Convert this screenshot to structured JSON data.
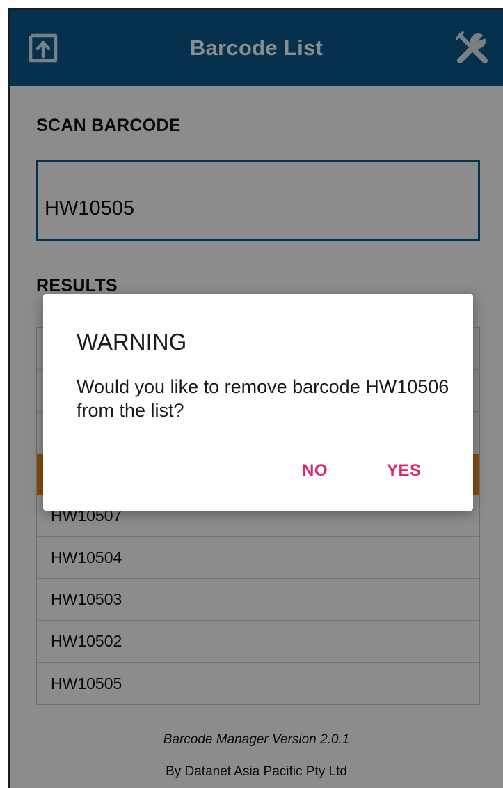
{
  "app_bar": {
    "title": "Barcode List",
    "left_icon": "upload-icon",
    "right_icon": "wrench-settings-icon"
  },
  "scan": {
    "label": "SCAN BARCODE",
    "value": "HW10505"
  },
  "results": {
    "label": "RESULTS",
    "items": [
      "",
      "",
      "",
      "HW10507",
      "HW10504",
      "HW10503",
      "HW10502",
      "HW10505"
    ]
  },
  "footer": {
    "version": "Barcode Manager Version 2.0.1",
    "by": "By Datanet Asia Pacific Pty Ltd"
  },
  "dialog": {
    "title": "WARNING",
    "message": "Would you like to remove barcode HW10506 from the list?",
    "no_label": "NO",
    "yes_label": "YES"
  },
  "colors": {
    "app_bar": "#0a5a8f",
    "selected_row": "#f28a1a",
    "dialog_button": "#e0246f"
  }
}
